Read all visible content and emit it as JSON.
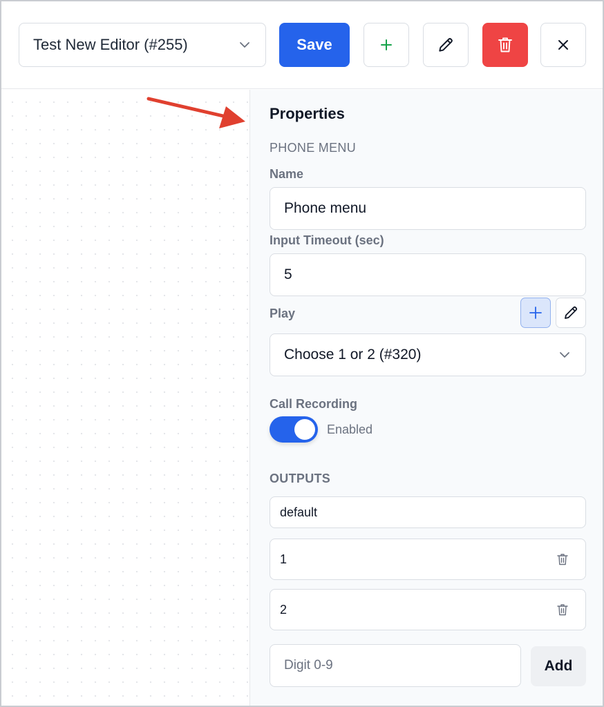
{
  "toolbar": {
    "flow_select_value": "Test New Editor (#255)",
    "save_label": "Save"
  },
  "panel": {
    "title": "Properties",
    "node_type": "PHONE MENU",
    "name_label": "Name",
    "name_value": "Phone menu",
    "timeout_label": "Input Timeout (sec)",
    "timeout_value": "5",
    "play_label": "Play",
    "play_value": "Choose 1 or 2 (#320)",
    "recording_label": "Call Recording",
    "recording_state": "Enabled",
    "outputs_label": "OUTPUTS",
    "outputs": [
      {
        "label": "default"
      },
      {
        "label": "1"
      },
      {
        "label": "2"
      }
    ],
    "digit_placeholder": "Digit 0-9",
    "add_label": "Add"
  },
  "colors": {
    "primary": "#2563eb",
    "danger": "#ef4444",
    "add_green": "#16a34a",
    "annotation_arrow": "#e0402f"
  }
}
